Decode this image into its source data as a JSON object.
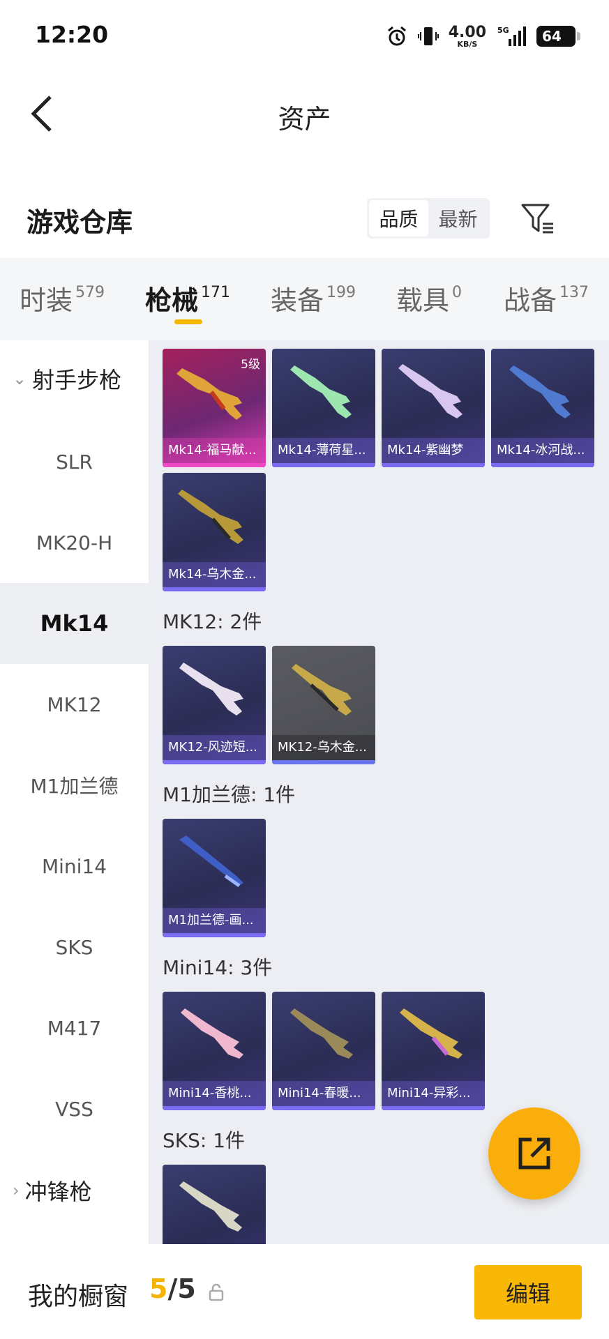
{
  "status_bar": {
    "time": "12:20",
    "speed_value": "4.00",
    "speed_unit": "KB/S",
    "network": "5G",
    "battery": "64",
    "icons": [
      "alarm-icon",
      "vibrate-icon",
      "signal-icon",
      "battery-icon"
    ]
  },
  "header": {
    "title": "资产",
    "back_icon": "chevron-left-icon"
  },
  "section": {
    "title": "游戏仓库",
    "sort_options": [
      "品质",
      "最新"
    ],
    "sort_selected": "品质",
    "filter_icon": "filter-icon"
  },
  "tabs": [
    {
      "label": "时装",
      "count": "579"
    },
    {
      "label": "枪械",
      "count": "171",
      "active": true
    },
    {
      "label": "装备",
      "count": "199"
    },
    {
      "label": "载具",
      "count": "0"
    },
    {
      "label": "战备",
      "count": "137"
    }
  ],
  "sidebar": {
    "group_open": "射手步枪",
    "items": [
      "SLR",
      "MK20-H",
      "Mk14",
      "MK12",
      "M1加兰德",
      "Mini14",
      "SKS",
      "M417",
      "VSS"
    ],
    "selected": "Mk14",
    "group_closed": "冲锋枪"
  },
  "groups": [
    {
      "label": "",
      "items": [
        {
          "name": "Mk14-福马献...",
          "badge": "5级",
          "rarity": "gold"
        },
        {
          "name": "Mk14-薄荷星...",
          "rarity": "purple"
        },
        {
          "name": "Mk14-紫幽梦",
          "rarity": "purple"
        },
        {
          "name": "Mk14-冰河战...",
          "rarity": "purple"
        },
        {
          "name": "Mk14-乌木金...",
          "rarity": "purple"
        }
      ]
    },
    {
      "label": "MK12: 2件",
      "items": [
        {
          "name": "MK12-风迹短...",
          "rarity": "purple"
        },
        {
          "name": "MK12-乌木金...",
          "rarity": "grey"
        }
      ]
    },
    {
      "label": "M1加兰德: 1件",
      "items": [
        {
          "name": "M1加兰德-画...",
          "rarity": "purple"
        }
      ]
    },
    {
      "label": "Mini14: 3件",
      "items": [
        {
          "name": "Mini14-香桃...",
          "rarity": "purple"
        },
        {
          "name": "Mini14-春暖...",
          "rarity": "purple"
        },
        {
          "name": "Mini14-异彩...",
          "rarity": "purple"
        }
      ]
    },
    {
      "label": "SKS: 1件",
      "items": [
        {
          "name": "",
          "rarity": "purple"
        }
      ]
    }
  ],
  "fab": {
    "icon": "share-icon"
  },
  "bottom": {
    "label": "我的橱窗",
    "count_current": "5",
    "count_separator": "/",
    "count_total": "5",
    "lock_icon": "lock-icon",
    "edit_label": "编辑"
  },
  "colors": {
    "accent": "#f5b800",
    "edit_button": "#f9b708",
    "fab": "#f9ae0b",
    "card_purple": "#2b2d55",
    "card_gold": "#a4215d",
    "card_grey": "#4b4c52"
  }
}
